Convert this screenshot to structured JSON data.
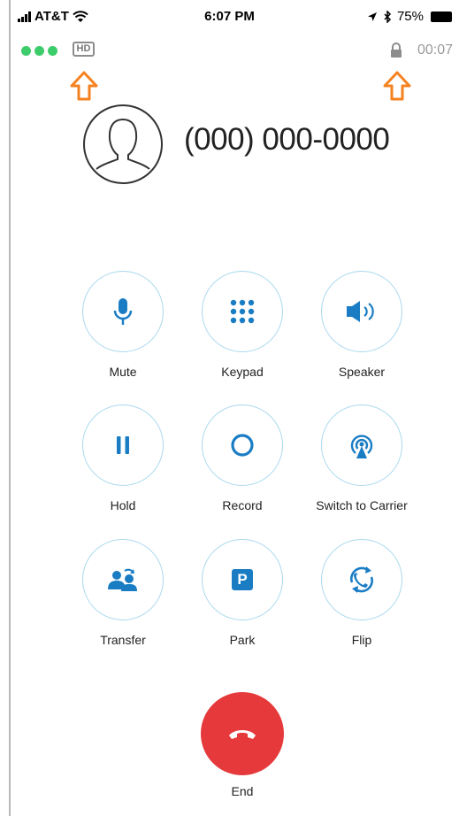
{
  "status_bar": {
    "carrier": "AT&T",
    "time": "6:07 PM",
    "battery": "75%"
  },
  "call_info": {
    "hd_badge": "HD",
    "duration": "00:07",
    "quality_colors": [
      "#3dcc6a",
      "#3dcc6a",
      "#3dcc6a"
    ]
  },
  "caller": {
    "number": "(000) 000-0000"
  },
  "controls": {
    "mute": "Mute",
    "keypad": "Keypad",
    "speaker": "Speaker",
    "hold": "Hold",
    "record": "Record",
    "switch_to_carrier": "Switch to Carrier",
    "transfer": "Transfer",
    "park": "Park",
    "flip": "Flip",
    "park_glyph": "P"
  },
  "end_call": {
    "label": "End"
  },
  "colors": {
    "accent": "#1a7dc4",
    "circle_border": "#a9d8ee",
    "end": "#e5393b",
    "annotation_arrow": "#f58220"
  },
  "icons": {
    "annotation": "up-arrow-icon"
  }
}
